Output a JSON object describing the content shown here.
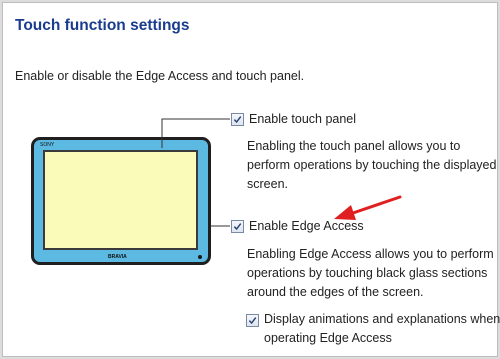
{
  "page": {
    "title": "Touch function settings",
    "subtitle": "Enable or disable the Edge Access and touch panel."
  },
  "options": {
    "touch_panel": {
      "label": "Enable touch panel",
      "checked": true,
      "description": [
        "Enabling the touch panel allows you to",
        "perform operations by touching the displayed",
        "screen."
      ]
    },
    "edge_access": {
      "label": "Enable Edge Access",
      "checked": true,
      "description": [
        "Enabling Edge Access allows you to perform",
        "operations by touching black glass sections",
        "around the edges of the screen."
      ]
    },
    "animations": {
      "label": [
        "Display animations and explanations when",
        "operating Edge Access"
      ],
      "checked": true
    }
  },
  "device": {
    "brand_top": "SONY",
    "brand_bottom": "BRAVIA"
  },
  "colors": {
    "title": "#1a3c8f",
    "device_frame": "#5bb9e2",
    "screen": "#fafbb8",
    "arrow": "#e02020"
  }
}
